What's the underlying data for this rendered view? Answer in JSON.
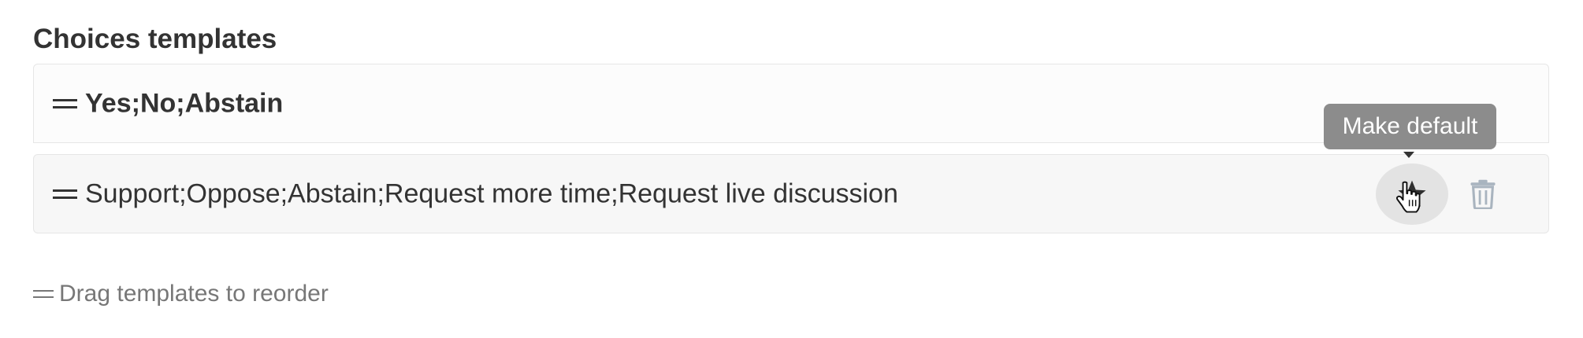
{
  "section": {
    "title": "Choices templates"
  },
  "templates": [
    {
      "label": "Yes;No;Abstain",
      "is_default": true
    },
    {
      "label": "Support;Oppose;Abstain;Request more time;Request live discussion",
      "is_default": false
    }
  ],
  "actions": {
    "make_default_icon": "star-icon",
    "delete_icon": "trash-icon",
    "tooltip_text": "Make default"
  },
  "hint": {
    "text": "Drag templates to reorder",
    "icon": "drag-handle-icon"
  },
  "colors": {
    "text": "#333333",
    "muted_text": "#777777",
    "row_border": "#e6e6e6",
    "tooltip_bg": "#8c8c8c",
    "hover_circle": "#e3e3e3",
    "trash_icon": "#a9b4bf"
  }
}
